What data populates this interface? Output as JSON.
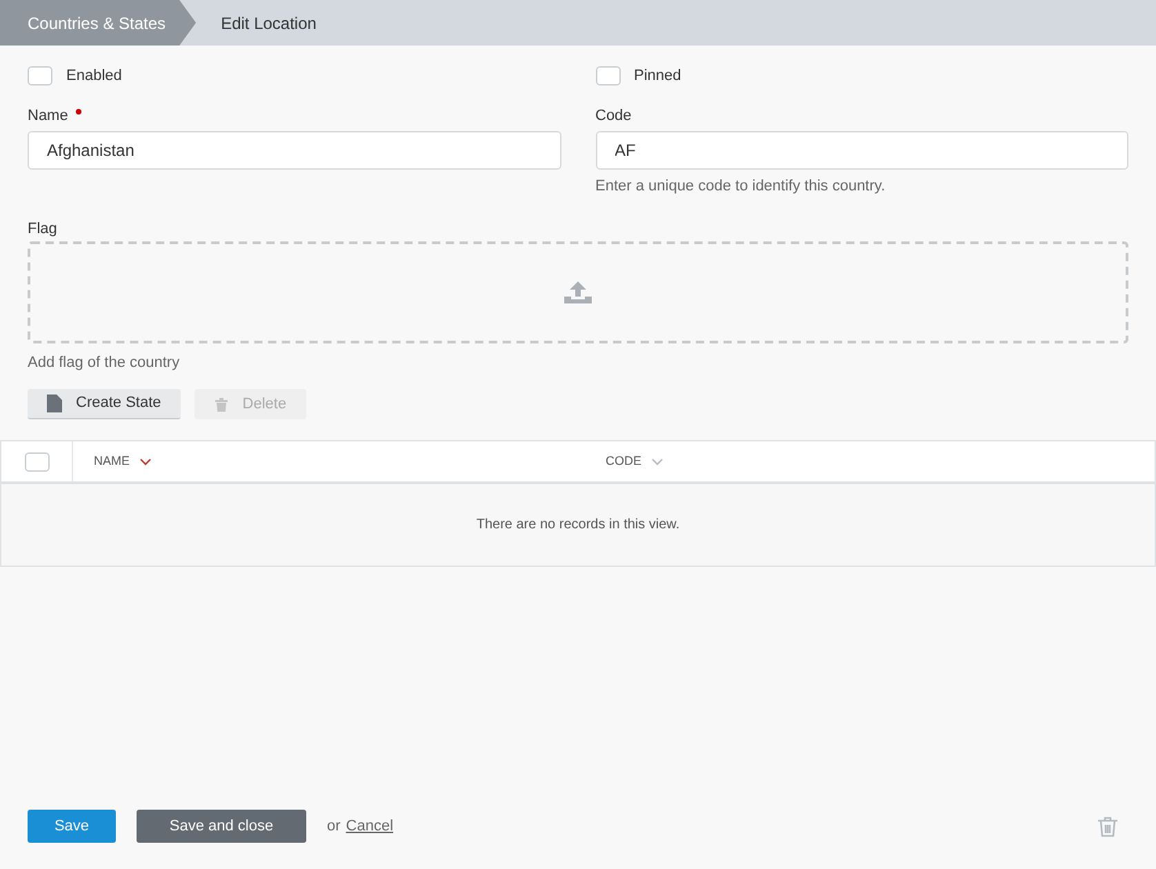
{
  "breadcrumbs": [
    {
      "label": "Countries & States",
      "selected": false
    },
    {
      "label": "Edit Location",
      "selected": true
    }
  ],
  "toggles": [
    {
      "label": "Enabled",
      "checked": false
    },
    {
      "label": "Pinned",
      "checked": false
    }
  ],
  "fields": [
    {
      "label": "Name",
      "required": true,
      "value": "Afghanistan"
    },
    {
      "label": "Code",
      "required": false,
      "value": "AF",
      "help": "Enter a unique code to identify this country."
    }
  ],
  "flag": {
    "label": "Flag",
    "help": "Add flag of the country"
  },
  "toolbar": [
    {
      "kind": "create",
      "label": "Create State",
      "disabled": false
    },
    {
      "kind": "delete",
      "label": "Delete",
      "disabled": true
    }
  ],
  "table": {
    "select_all": {
      "checked": false
    },
    "columns": [
      {
        "label": "NAME",
        "sorted": true
      },
      {
        "label": "CODE",
        "sorted": false
      }
    ],
    "empty_message": "There are no records in this view."
  },
  "footer": {
    "save": "Save",
    "save_and_close": "Save and close",
    "or": "or",
    "cancel": "Cancel"
  }
}
